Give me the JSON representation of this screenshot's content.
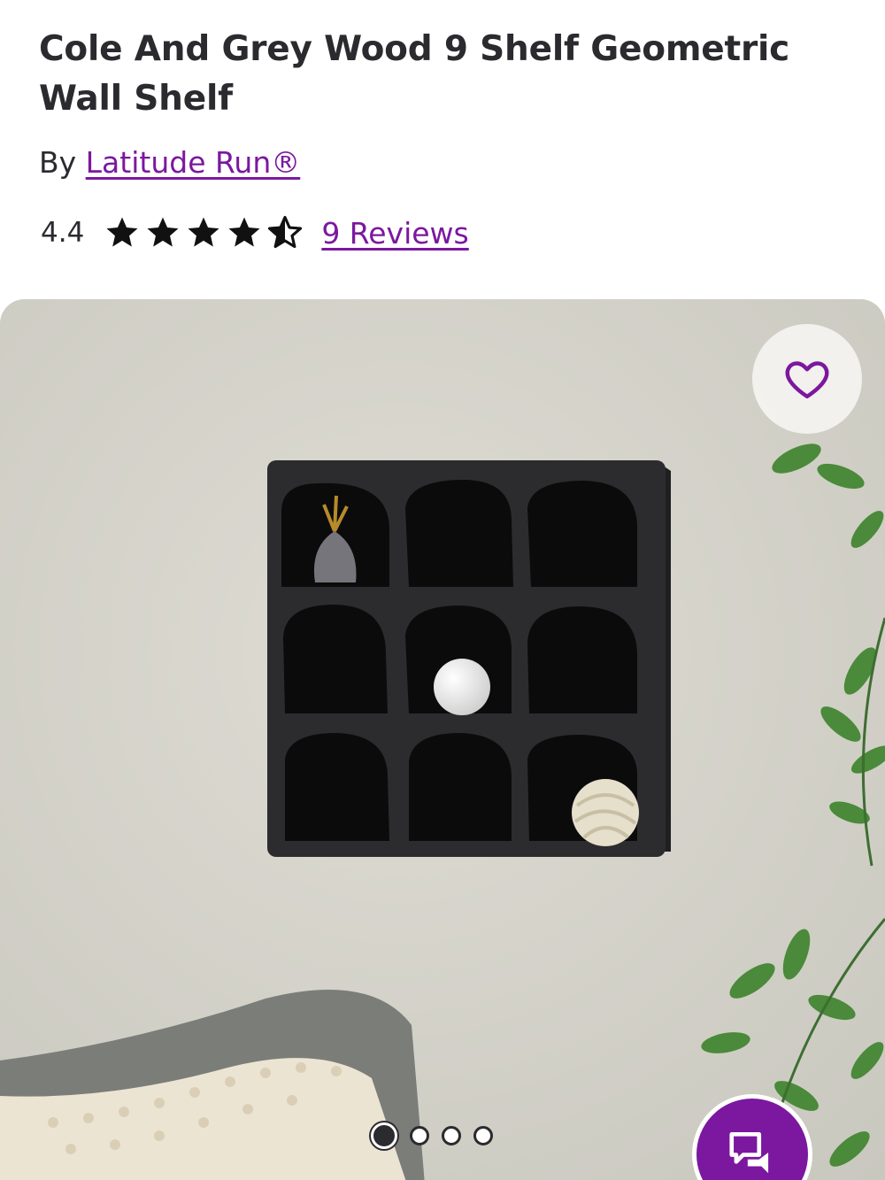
{
  "product": {
    "title": "Cole And Grey Wood 9 Shelf Geometric Wall Shelf",
    "by_prefix": "By",
    "brand": "Latitude Run®",
    "rating": "4.4",
    "rating_value": 4.4,
    "rating_max": 5,
    "reviews_link": "9 Reviews"
  },
  "gallery": {
    "favorite_icon": "heart-outline-icon",
    "chat_icon": "chat-bubbles-icon",
    "dot_count": 4,
    "active_dot": 0
  },
  "colors": {
    "accent": "#7b189f",
    "text": "#2b2a2e",
    "wall": "#d9d9d0",
    "shelf": "#2a2a2c"
  }
}
